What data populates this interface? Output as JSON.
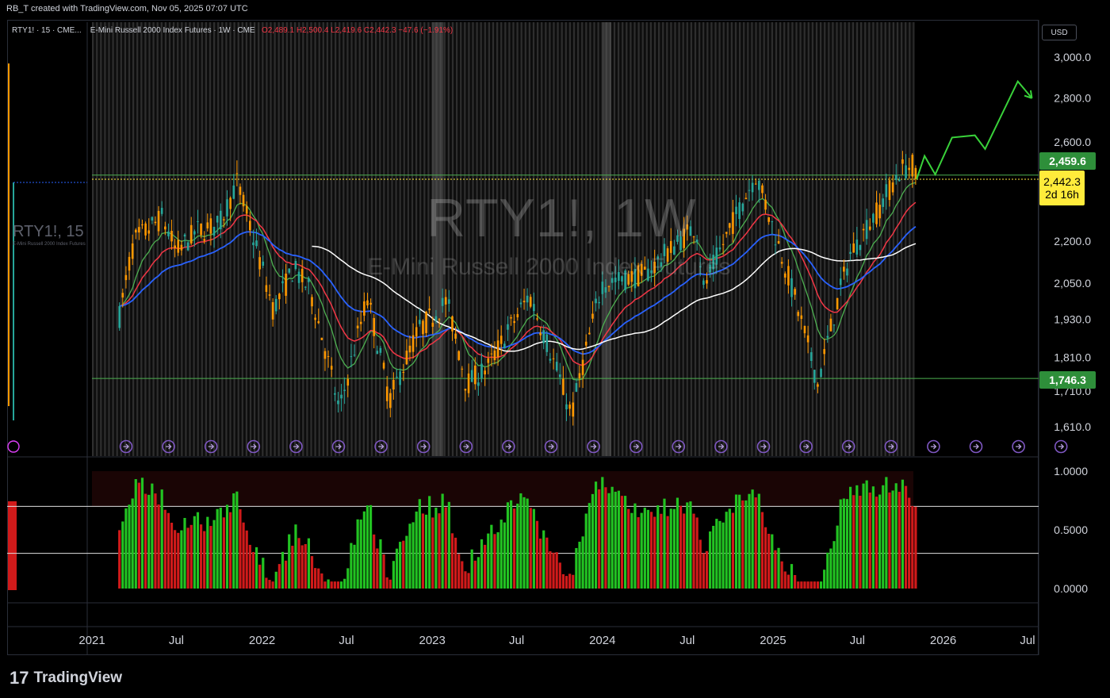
{
  "top_caption": "RB_T created with TradingView.com, Nov 05, 2025 07:07 UTC",
  "currency_button": "USD",
  "legend": {
    "left_symbol": "RTY1! · 15 · CME...",
    "main_symbol": "E-Mini Russell 2000 Index Futures · 1W · CME",
    "ohlc": "O2,489.1  H2,500.4  L2,419.6  C2,442.3  −47.6 (−1.91%)"
  },
  "left_panel": {
    "label": "RTY1!, 15",
    "sublabel": "E-Mini Russell 2000 Index Futures"
  },
  "watermark": {
    "title": "RTY1!, 1W",
    "subtitle": "E-Mini Russell 2000 Index Futures"
  },
  "price_tags": {
    "upper_level": "2,459.6",
    "last_price": "2,442.3",
    "countdown": "2d 16h",
    "lower_level": "1,746.3"
  },
  "logo": {
    "mark": "17",
    "text": "TradingView"
  },
  "colors": {
    "up": "#26a69a",
    "down": "#ff9800",
    "ema_fast": "#4caf50",
    "ema_mid": "#f23645",
    "ema_slow": "#2962ff",
    "sma_long": "#ffffff",
    "hline": "#4caf50",
    "projection": "#39d23a",
    "ind_up": "#22c322",
    "ind_down": "#d01a1a"
  },
  "chart_data": {
    "type": "candlestick",
    "title": "E-Mini Russell 2000 Index Futures · 1W · CME",
    "timeframe": "1W",
    "x_tick_labels": [
      "2021",
      "Jul",
      "2022",
      "Jul",
      "2023",
      "Jul",
      "2024",
      "Jul",
      "2025",
      "Jul",
      "2026",
      "Jul"
    ],
    "y_tick_labels": [
      "3,000.0",
      "2,800.0",
      "2,600.0",
      "2,200.0",
      "2,050.0",
      "1,930.0",
      "1,810.0",
      "1,710.0",
      "1,610.0"
    ],
    "y_ticks": [
      3000,
      2800,
      2600,
      2200,
      2050,
      1930,
      1810,
      1710,
      1610
    ],
    "ylim": [
      1560,
      3100
    ],
    "scale": "log",
    "horizontal_levels": [
      2459.6,
      1746.3
    ],
    "last_price": 2442.3,
    "ohlc_last": {
      "open": 2489.1,
      "high": 2500.4,
      "low": 2419.6,
      "close": 2442.3,
      "change": -47.6,
      "change_pct": -1.91
    },
    "price_path": [
      [
        "2021-03-01",
        1940
      ],
      [
        "2021-04-01",
        2200
      ],
      [
        "2021-06-01",
        2290
      ],
      [
        "2021-07-01",
        2160
      ],
      [
        "2021-08-15",
        2240
      ],
      [
        "2021-10-01",
        2260
      ],
      [
        "2021-11-08",
        2430
      ],
      [
        "2021-12-15",
        2200
      ],
      [
        "2022-01-25",
        1960
      ],
      [
        "2022-03-10",
        2100
      ],
      [
        "2022-04-15",
        2020
      ],
      [
        "2022-06-16",
        1650
      ],
      [
        "2022-08-15",
        2000
      ],
      [
        "2022-10-01",
        1680
      ],
      [
        "2022-12-01",
        1890
      ],
      [
        "2023-02-01",
        1990
      ],
      [
        "2023-03-15",
        1730
      ],
      [
        "2023-05-01",
        1780
      ],
      [
        "2023-07-28",
        2010
      ],
      [
        "2023-10-27",
        1640
      ],
      [
        "2024-01-01",
        2050
      ],
      [
        "2024-04-01",
        2080
      ],
      [
        "2024-07-20",
        2260
      ],
      [
        "2024-08-05",
        2030
      ],
      [
        "2024-11-25",
        2460
      ],
      [
        "2025-01-01",
        2250
      ],
      [
        "2025-04-07",
        1730
      ],
      [
        "2025-06-15",
        2150
      ],
      [
        "2025-08-15",
        2320
      ],
      [
        "2025-10-01",
        2480
      ],
      [
        "2025-10-27",
        2500
      ],
      [
        "2025-11-05",
        2442.3
      ]
    ],
    "forecast_path": [
      [
        "2025-11-05",
        2442
      ],
      [
        "2025-11-22",
        2540
      ],
      [
        "2025-12-15",
        2462
      ],
      [
        "2026-01-20",
        2620
      ],
      [
        "2026-03-10",
        2630
      ],
      [
        "2026-04-01",
        2570
      ],
      [
        "2026-06-10",
        2880
      ],
      [
        "2026-06-25",
        2840
      ]
    ],
    "moving_averages": [
      {
        "color_key": "ema_fast"
      },
      {
        "color_key": "ema_mid"
      },
      {
        "color_key": "ema_slow"
      },
      {
        "color_key": "sma_long"
      }
    ],
    "indicator": {
      "y_tick_labels": [
        "1.0000",
        "0.5000",
        "0.0000"
      ],
      "ylim": [
        0,
        1
      ],
      "hlines": [
        0.7,
        0.3
      ]
    }
  }
}
